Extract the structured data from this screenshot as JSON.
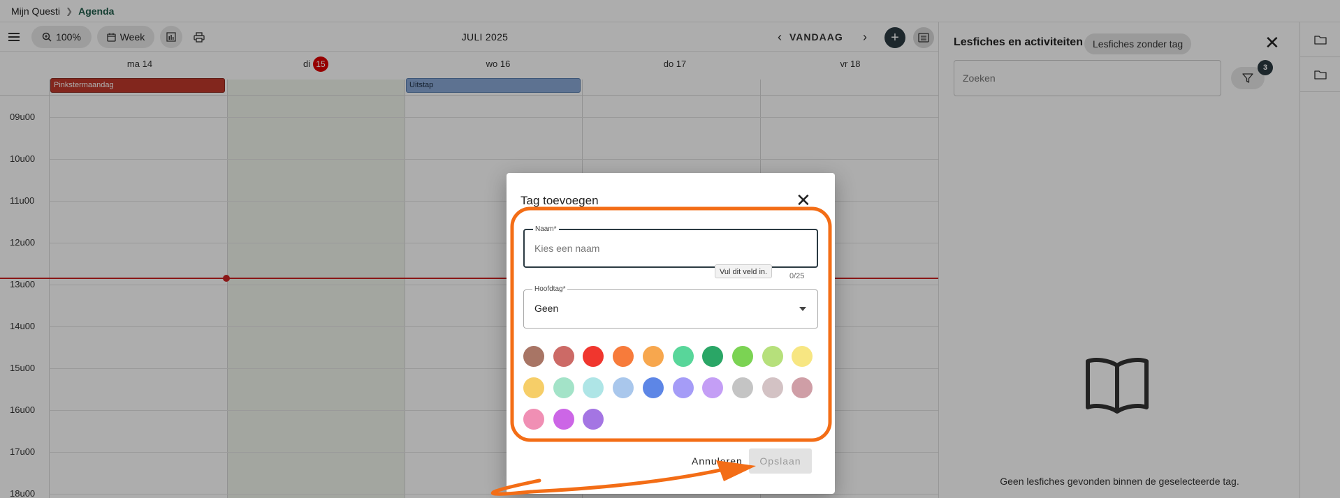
{
  "breadcrumb": {
    "root": "Mijn Questi",
    "separator": ">",
    "current": "Agenda"
  },
  "toolbar": {
    "zoom": "100%",
    "view": "Week",
    "month": "JULI 2025",
    "today": "VANDAAG",
    "add": "+"
  },
  "calendar": {
    "days": [
      {
        "label": "ma 14"
      },
      {
        "label": "di",
        "badge": "15"
      },
      {
        "label": "wo 16"
      },
      {
        "label": "do 17"
      },
      {
        "label": "vr 18"
      }
    ],
    "events": [
      {
        "label": "Pinkstermaandag",
        "color": "#c0392b"
      },
      {
        "label": "Uitstap",
        "color": "#8aa9d6"
      }
    ],
    "hours": [
      "09u00",
      "10u00",
      "11u00",
      "12u00",
      "13u00",
      "14u00",
      "15u00",
      "16u00",
      "17u00",
      "18u00"
    ]
  },
  "panel": {
    "title": "Lesfiches en activiteiten",
    "chip": "Lesfiches zonder tag",
    "search_placeholder": "Zoeken",
    "filter_count": "3",
    "empty_text": "Geen lesfiches gevonden binnen de geselecteerde tag."
  },
  "dialog": {
    "title": "Tag toevoegen",
    "name_label": "Naam*",
    "name_placeholder": "Kies een naam",
    "tooltip": "Vul dit veld in.",
    "counter": "0/25",
    "main_label": "Hoofdtag*",
    "main_value": "Geen",
    "cancel": "Annuleren",
    "save": "Opslaan",
    "colors": [
      "#a87565",
      "#cc6a66",
      "#f0362e",
      "#f77b3b",
      "#f7a74e",
      "#58d69a",
      "#2aa666",
      "#7bd353",
      "#b6e07b",
      "#f7e682",
      "#f6ce68",
      "#a3e3c8",
      "#aee5e6",
      "#a9c7ec",
      "#5d86e6",
      "#a59cf7",
      "#c49ef5",
      "#c4c4c4",
      "#d3c2c4",
      "#cf9ea6",
      "#f08fb4",
      "#cc66e6",
      "#a475e3"
    ]
  },
  "annotation_color": "#f36d16"
}
